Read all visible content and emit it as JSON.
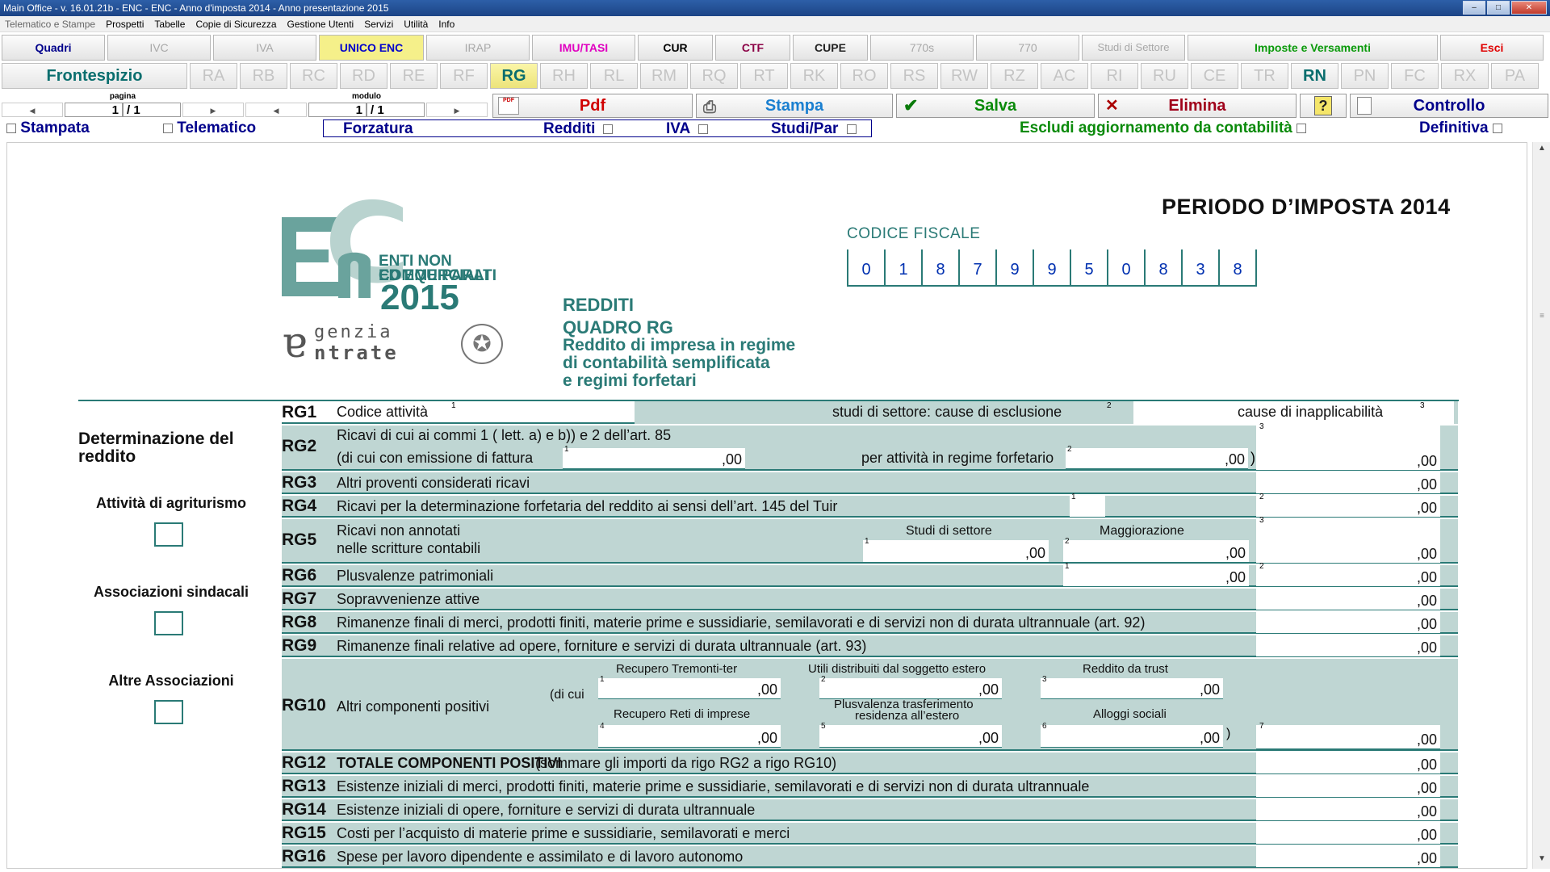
{
  "window": {
    "title": "Main Office - v. 16.01.21b - ENC - ENC - Anno d'imposta 2014 - Anno presentazione 2015"
  },
  "menu": [
    "Telematico e Stampe",
    "Prospetti",
    "Tabelle",
    "Copie di Sicurezza",
    "Gestione Utenti",
    "Servizi",
    "Utilità",
    "Info"
  ],
  "tabs": [
    {
      "label": "Quadri",
      "color": "#00008b"
    },
    {
      "label": "IVC",
      "color": "#a8a8a8"
    },
    {
      "label": "IVA",
      "color": "#a8a8a8"
    },
    {
      "label": "UNICO ENC",
      "color": "#0000cc",
      "bg": "#f5f08a"
    },
    {
      "label": "IRAP",
      "color": "#a8a8a8"
    },
    {
      "label": "IMU/TASI",
      "color": "#e000c0"
    },
    {
      "label": "CUR",
      "color": "#000000"
    },
    {
      "label": "CTF",
      "color": "#8b0045"
    },
    {
      "label": "CUPE",
      "color": "#222222"
    },
    {
      "label": "770s",
      "color": "#a8a8a8"
    },
    {
      "label": "770",
      "color": "#a8a8a8"
    },
    {
      "label": "Studi di Settore",
      "color": "#a8a8a8"
    },
    {
      "label": "Imposte e Versamenti",
      "color": "#0a9a0a"
    },
    {
      "label": "Esci",
      "color": "#e00000"
    }
  ],
  "quadri": {
    "frontespizio": "Frontespizio",
    "items": [
      "RA",
      "RB",
      "RC",
      "RD",
      "RE",
      "RF",
      "RG",
      "RH",
      "RL",
      "RM",
      "RQ",
      "RT",
      "RK",
      "RO",
      "RS",
      "RW",
      "RZ",
      "AC",
      "RI",
      "RU",
      "CE",
      "TR",
      "RN",
      "PN",
      "FC",
      "RX",
      "PA"
    ],
    "active": "RG",
    "enabled": "RN"
  },
  "pager": {
    "pagina_label": "pagina",
    "pagina_value": "1",
    "pagina_total": "/ 1",
    "modulo_label": "modulo",
    "modulo_value": "1",
    "modulo_total": "/ 1"
  },
  "actions": {
    "pdf": "Pdf",
    "stampa": "Stampa",
    "salva": "Salva",
    "elimina": "Elimina",
    "help": "?",
    "controllo": "Controllo"
  },
  "flags": {
    "stampata": "Stampata",
    "telematico": "Telematico",
    "forzatura": "Forzatura",
    "redditi": "Redditi",
    "iva": "IVA",
    "studi": "Studi/Par",
    "escludi": "Escludi aggiornamento da contabilità",
    "definitiva": "Definitiva"
  },
  "form": {
    "logo_line1": "ENTI NON COMMERCIALI",
    "logo_line2": "ED EQUIPARATI",
    "logo_year": "2015",
    "agenzia_1": "genzia",
    "agenzia_2": "ntrate",
    "periodo": "PERIODO D’IMPOSTA 2014",
    "cf_label": "CODICE FISCALE",
    "cf_digits": [
      "0",
      "1",
      "8",
      "7",
      "9",
      "9",
      "5",
      "0",
      "8",
      "3",
      "8"
    ],
    "title1": "REDDITI",
    "title2": "QUADRO RG",
    "title3": "Reddito di impresa in regime",
    "title4": "di contabilità semplificata",
    "title5": "e regimi forfetari",
    "section": "Determinazione del reddito",
    "side1": "Attività di agriturismo",
    "side2": "Associazioni sindacali",
    "side3": "Altre Associazioni",
    "zero": ",00",
    "rg1": {
      "code": "RG1",
      "desc": "Codice attività",
      "studi": "studi di settore:  cause di esclusione",
      "inapp": "cause di inapplicabilità"
    },
    "rg2": {
      "code": "RG2",
      "desc": "Ricavi di cui ai commi 1 ( lett. a) e b)) e 2 dell’art. 85",
      "desc2": "(di cui con emissione di fattura",
      "forf": "per attività in regime forfetario"
    },
    "rg3": {
      "code": "RG3",
      "desc": "Altri proventi considerati ricavi"
    },
    "rg4": {
      "code": "RG4",
      "desc": "Ricavi per la determinazione forfetaria del reddito ai sensi dell’art. 145 del Tuir"
    },
    "rg5": {
      "code": "RG5",
      "desc": "Ricavi non annotati",
      "desc2": "nelle scritture contabili",
      "col1": "Studi di settore",
      "col2": "Maggiorazione"
    },
    "rg6": {
      "code": "RG6",
      "desc": "Plusvalenze patrimoniali"
    },
    "rg7": {
      "code": "RG7",
      "desc": "Sopravvenienze attive"
    },
    "rg8": {
      "code": "RG8",
      "desc": "Rimanenze finali di merci, prodotti finiti, materie prime e sussidiarie, semilavorati e di servizi non di durata ultrannuale (art. 92)"
    },
    "rg9": {
      "code": "RG9",
      "desc": "Rimanenze finali relative ad opere, forniture e servizi di durata ultrannuale (art. 93)"
    },
    "rg10": {
      "code": "RG10",
      "desc": "Altri componenti positivi",
      "dicui": "(di cui",
      "c1": "Recupero Tremonti-ter",
      "c2": "Utili distribuiti dal soggetto estero",
      "c3": "Reddito da trust",
      "c4": "Recupero Reti di imprese",
      "c5a": "Plusvalenza trasferimento",
      "c5b": "residenza all’estero",
      "c6": "Alloggi sociali"
    },
    "rg12": {
      "code": "RG12",
      "desc": "TOTALE COMPONENTI POSITIVI",
      "desc2": "(sommare gli importi da rigo RG2 a rigo RG10)"
    },
    "rg13": {
      "code": "RG13",
      "desc": "Esistenze iniziali di merci, prodotti finiti, materie prime e sussidiarie, semilavorati e di servizi non di durata ultrannuale"
    },
    "rg14": {
      "code": "RG14",
      "desc": "Esistenze iniziali di opere, forniture e servizi di durata ultrannuale"
    },
    "rg15": {
      "code": "RG15",
      "desc": "Costi per l’acquisto di materie prime e sussidiarie, semilavorati e merci"
    },
    "rg16": {
      "code": "RG16",
      "desc": "Spese per lavoro dipendente e assimilato e di lavoro autonomo"
    }
  }
}
